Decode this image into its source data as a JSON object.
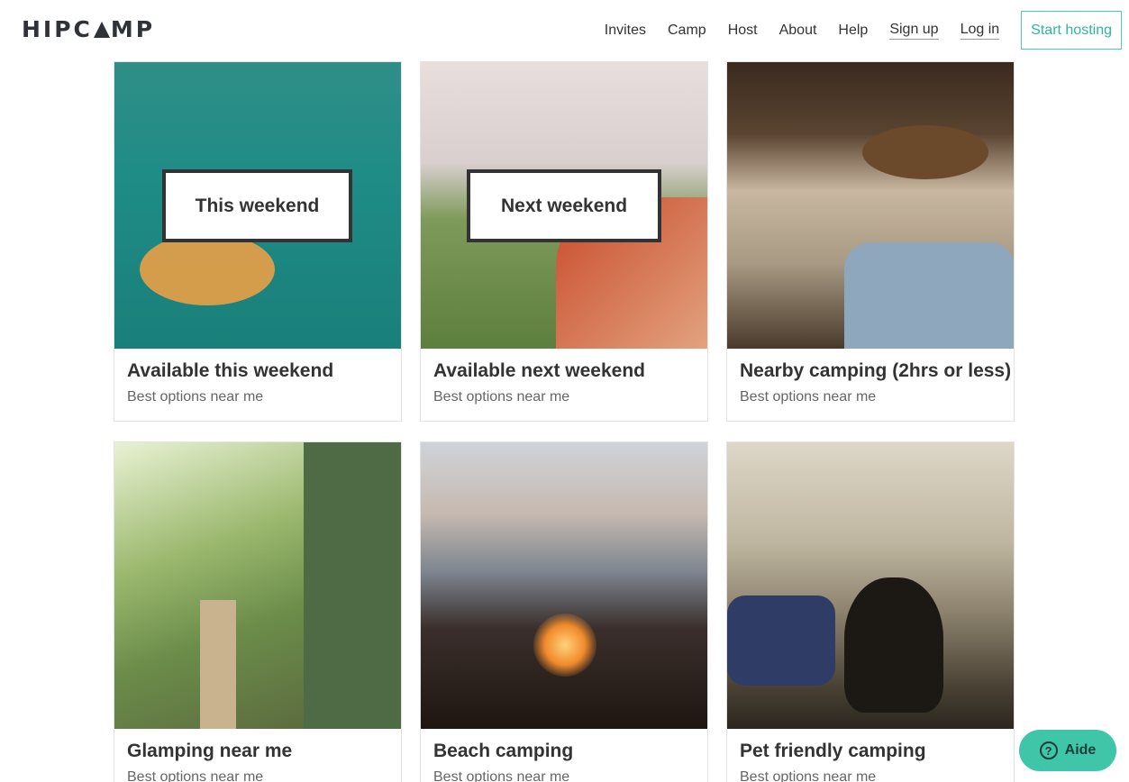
{
  "brand": {
    "logo_text_a": "HIPC",
    "logo_text_b": "MP"
  },
  "nav": {
    "items": [
      "Invites",
      "Camp",
      "Host",
      "About",
      "Help",
      "Sign up",
      "Log in"
    ],
    "cta": "Start hosting"
  },
  "cards": [
    {
      "overlay": "This weekend",
      "title": "Available this weekend",
      "subtitle": "Best options near me"
    },
    {
      "overlay": "Next weekend",
      "title": "Available next weekend",
      "subtitle": "Best options near me"
    },
    {
      "title": "Nearby camping (2hrs or less)",
      "subtitle": "Best options near me"
    },
    {
      "title": "Glamping near me",
      "subtitle": "Best options near me"
    },
    {
      "title": "Beach camping",
      "subtitle": "Best options near me"
    },
    {
      "title": "Pet friendly camping",
      "subtitle": "Best options near me"
    }
  ],
  "help": {
    "label": "Aide"
  },
  "colors": {
    "accent": "#3fc6a9",
    "cta_border": "#4ec9b4",
    "text": "#333333"
  }
}
